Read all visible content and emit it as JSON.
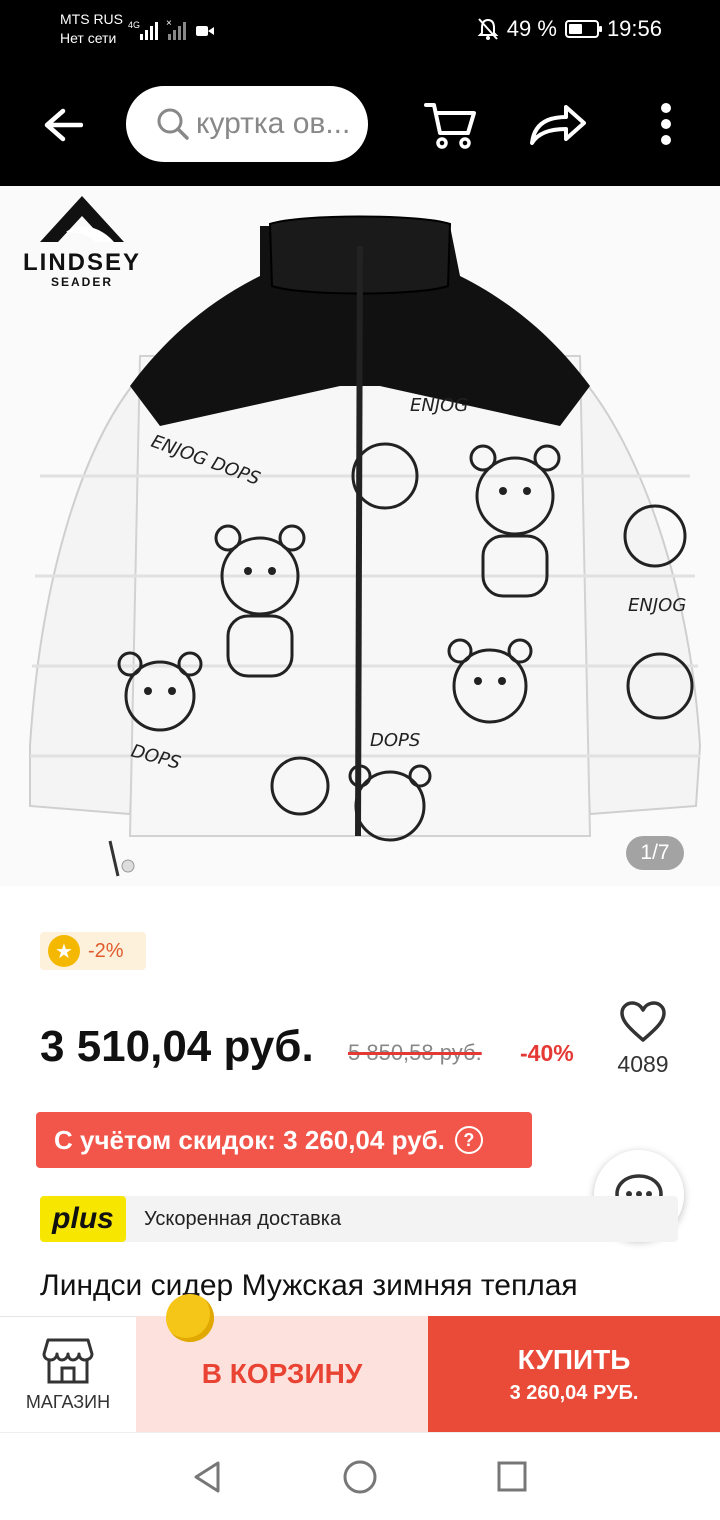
{
  "status_bar": {
    "carrier": "MTS RUS",
    "network_status": "Нет сети",
    "net_type": "4G",
    "battery": "49 %",
    "battery_level": 0.49,
    "time": "19:56"
  },
  "header": {
    "search_text": "куртка ов...",
    "icons": [
      "back-arrow-icon",
      "search-icon",
      "cart-icon",
      "share-icon",
      "more-icon"
    ]
  },
  "product": {
    "brand_line1": "LINDSEY",
    "brand_line2": "SEADER",
    "image_counter": "1/7",
    "coin_discount": "-2%",
    "price": "3 510,04 руб.",
    "old_price": "5 850,58 руб.",
    "discount": "-40%",
    "favorites_count": "4089",
    "with_discount": "С учётом скидок: 3 260,04 руб.",
    "plus_label": "plus",
    "delivery": "Ускоренная доставка",
    "title": "Линдси сидер Мужская зимняя теплая"
  },
  "bottom_bar": {
    "shop_label": "МАГАЗИН",
    "cart_label": "В КОРЗИНУ",
    "buy_label": "КУПИТЬ",
    "buy_price": "3 260,04 РУБ."
  },
  "colors": {
    "accent_red": "#ea4a38",
    "banner_red": "#f2554a",
    "plus_yellow": "#f6e600",
    "coin_gold": "#f5b800"
  }
}
